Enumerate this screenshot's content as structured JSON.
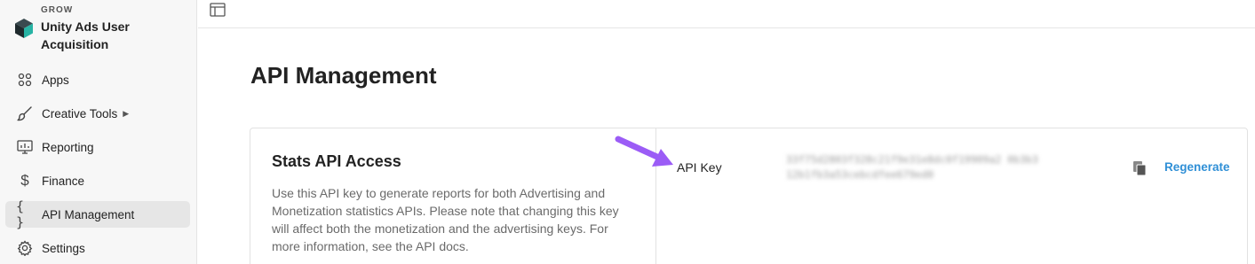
{
  "brand": {
    "kicker": "GROW",
    "title": "Unity Ads User Acquisition",
    "logo_icon": "unity-cube-icon"
  },
  "sidebar": {
    "items": [
      {
        "label": "Apps",
        "icon": "apps-grid-icon",
        "active": false
      },
      {
        "label": "Creative Tools",
        "icon": "paintbrush-icon",
        "active": false,
        "has_submenu": true
      },
      {
        "label": "Reporting",
        "icon": "reporting-chart-icon",
        "active": false
      },
      {
        "label": "Finance",
        "icon": "dollar-icon",
        "active": false
      },
      {
        "label": "API Management",
        "icon": "braces-icon",
        "active": true
      },
      {
        "label": "Settings",
        "icon": "gear-icon",
        "active": false
      }
    ]
  },
  "topbar": {
    "icon": "layout-panel-icon"
  },
  "main": {
    "page_title": "API Management",
    "card": {
      "title": "Stats API Access",
      "description": "Use this API key to generate reports for both Advertising and Monetization statistics APIs. Please note that changing this key will affect both the monetization and the advertising keys. For more information, see the API docs.",
      "api_key_label": "API Key",
      "api_key_value": "33f75d2803f328c21f9e31e8dc0f19909a2 0b3b312b1fb3a53cebcdfee679ed0",
      "copy_icon": "copy-icon",
      "regenerate_label": "Regenerate"
    }
  },
  "colors": {
    "accent_link": "#2f8fd6",
    "annotation_arrow": "#9b5cf6",
    "sidebar_bg": "#f7f7f7",
    "active_item_bg": "#e6e6e6"
  }
}
